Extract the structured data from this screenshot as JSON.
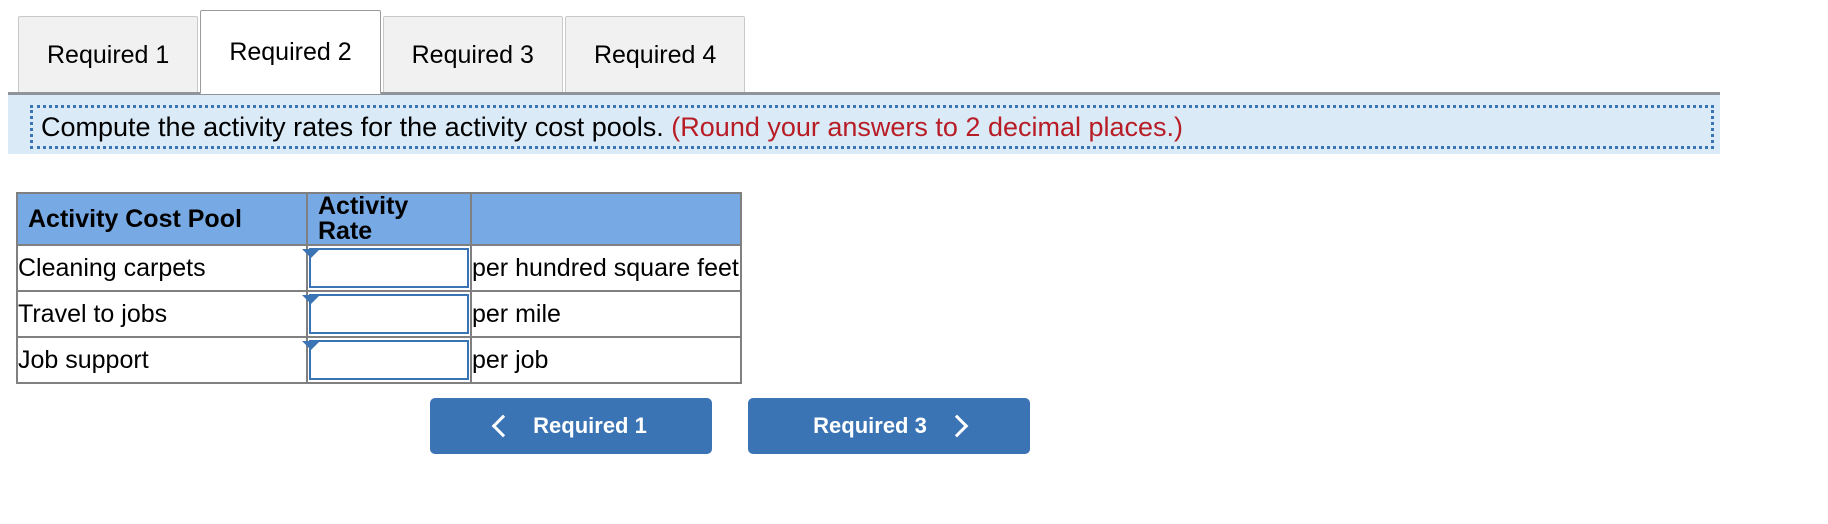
{
  "tabs": [
    {
      "label": "Required 1",
      "active": false
    },
    {
      "label": "Required 2",
      "active": true
    },
    {
      "label": "Required 3",
      "active": false
    },
    {
      "label": "Required 4",
      "active": false
    }
  ],
  "banner": {
    "instruction": "Compute the activity rates for the activity cost pools.",
    "note": "(Round your answers to 2 decimal places.)"
  },
  "table": {
    "headers": [
      "Activity Cost Pool",
      "Activity Rate",
      ""
    ],
    "rows": [
      {
        "pool": "Cleaning carpets",
        "rate": "",
        "unit": "per hundred square feet"
      },
      {
        "pool": "Travel to jobs",
        "rate": "",
        "unit": "per mile"
      },
      {
        "pool": "Job support",
        "rate": "",
        "unit": "per job"
      }
    ]
  },
  "nav": {
    "prev_label": "Required 1",
    "next_label": "Required 3",
    "prev_icon": "chevron-left-icon",
    "next_icon": "chevron-right-icon"
  },
  "colors": {
    "accent_blue": "#3b74b4",
    "header_blue": "#77aae4",
    "banner_blue": "#daeaf7",
    "note_red": "#b81d26"
  }
}
